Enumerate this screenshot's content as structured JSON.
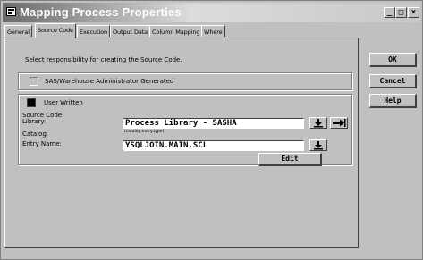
{
  "window": {
    "title": "Mapping Process Properties",
    "controls": {
      "minimize": "_",
      "maximize": "□",
      "close": "×"
    }
  },
  "tabs": [
    {
      "label": "General",
      "active": false
    },
    {
      "label": "Source Code",
      "active": true
    },
    {
      "label": "Execution",
      "active": false
    },
    {
      "label": "Output Data",
      "active": false
    },
    {
      "label": "Column Mapping",
      "active": false
    },
    {
      "label": "Where",
      "active": false
    }
  ],
  "source_code": {
    "instruction": "Select responsibility for creating the Source Code.",
    "option_generated": {
      "label": "SAS/Warehouse Administrator Generated",
      "selected": false
    },
    "option_user_written": {
      "label": "User Written",
      "selected": true
    },
    "source_code_label": "Source Code",
    "library_label": "Library:",
    "library_value": "Process Library - SASHA",
    "catalog_label": "Catalog",
    "catalog_hint": "(catalog.entry.type)",
    "entry_label": "Entry Name:",
    "entry_value": "YSQLJOIN.MAIN.SCL",
    "edit_label": "Edit"
  },
  "dialog_buttons": {
    "ok": "OK",
    "cancel": "Cancel",
    "help": "Help"
  },
  "icons": {
    "download_arrow": "download-arrow-icon",
    "right_arrow": "right-arrow-icon"
  }
}
